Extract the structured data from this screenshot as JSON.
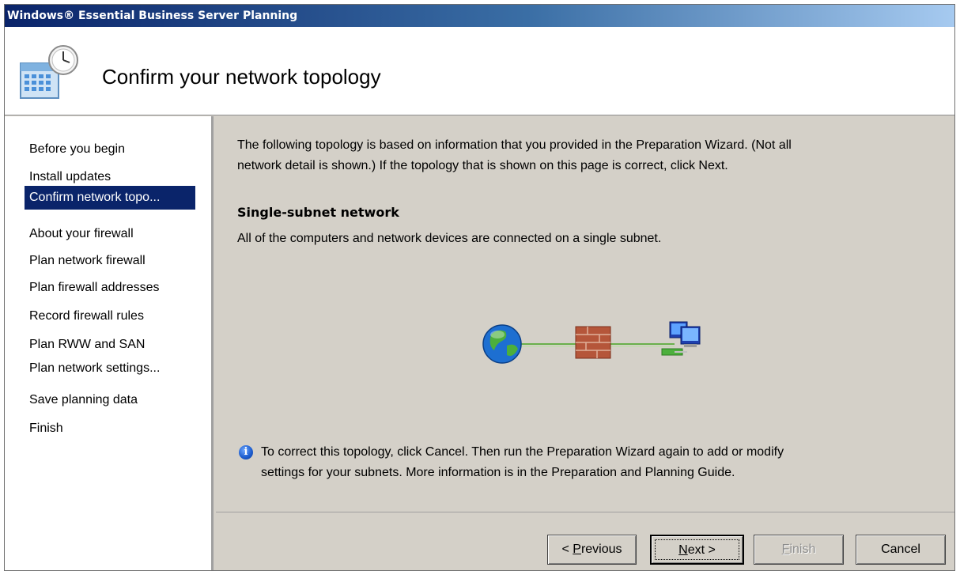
{
  "window": {
    "title": "Windows® Essential Business Server Planning"
  },
  "header": {
    "title": "Confirm your network topology",
    "icon": "calendar-clock-icon"
  },
  "sidebar": {
    "items": [
      {
        "label": "Before you begin"
      },
      {
        "label": "Install updates"
      },
      {
        "label": "Confirm network topo..."
      },
      {
        "label": "About your firewall"
      },
      {
        "label": "Plan network firewall"
      },
      {
        "label": "Plan firewall addresses"
      },
      {
        "label": "Record firewall rules"
      },
      {
        "label": "Plan RWW and SAN"
      },
      {
        "label": "Plan network settings..."
      },
      {
        "label": "Save planning data"
      },
      {
        "label": "Finish"
      }
    ],
    "active_index": 2,
    "active_color": "#0a246a"
  },
  "content": {
    "intro_line1": "The following topology is based on information that you provided in the Preparation Wizard. (Not all",
    "intro_line2": "network detail is shown.) If the topology that is shown on this page is correct, click Next.",
    "section_title": "Single-subnet network",
    "section_desc": "All of the computers and network devices are connected on a single subnet.",
    "topology_icons": [
      "globe-icon",
      "firewall-brick-icon",
      "computers-network-icon"
    ],
    "info_line1": "To correct this topology, click Cancel. Then run the Preparation Wizard again to add or modify",
    "info_line2": "settings for your subnets. More information is in the Preparation and Planning Guide."
  },
  "footer": {
    "previous_pre": "< ",
    "previous_key": "P",
    "previous_rest": "revious",
    "next_key": "N",
    "next_rest": "ext >",
    "finish_key": "F",
    "finish_rest": "inish",
    "cancel_label": "Cancel"
  },
  "colors": {
    "background": "#d4d0c8",
    "titlebar": "#0a246a",
    "link_line": "#6ab04c"
  }
}
